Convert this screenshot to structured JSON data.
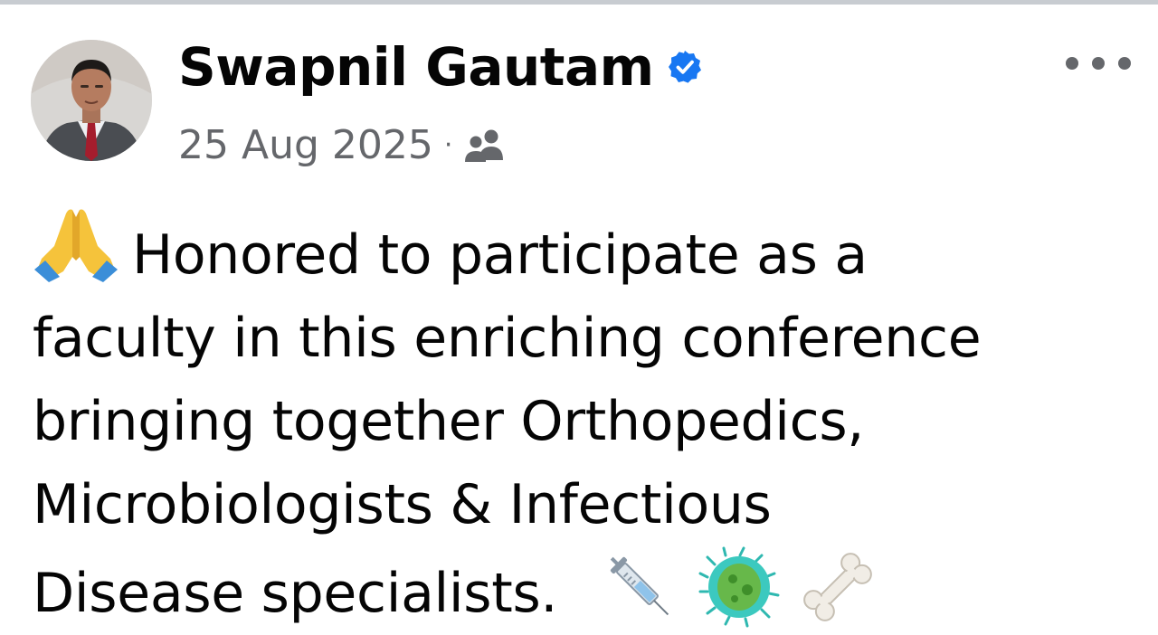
{
  "post": {
    "author": {
      "name": "Swapnil Gautam",
      "verified": true,
      "avatar_icon": "profile-photo"
    },
    "date": "25 Aug 2025",
    "separator": "·",
    "audience_icon": "friends-audience-icon",
    "more_icon": "more-options-icon",
    "text_lines": [
      "Honored to participate as a",
      "faculty in this enriching conference",
      "bringing together Orthopedics,",
      "Microbiologists & Infectious",
      "Disease specialists."
    ],
    "emojis": [
      "folded-hands",
      "syringe",
      "microbe",
      "bone"
    ]
  },
  "colors": {
    "text_primary": "#050505",
    "text_secondary": "#65676b",
    "verified_blue": "#1877f2"
  }
}
